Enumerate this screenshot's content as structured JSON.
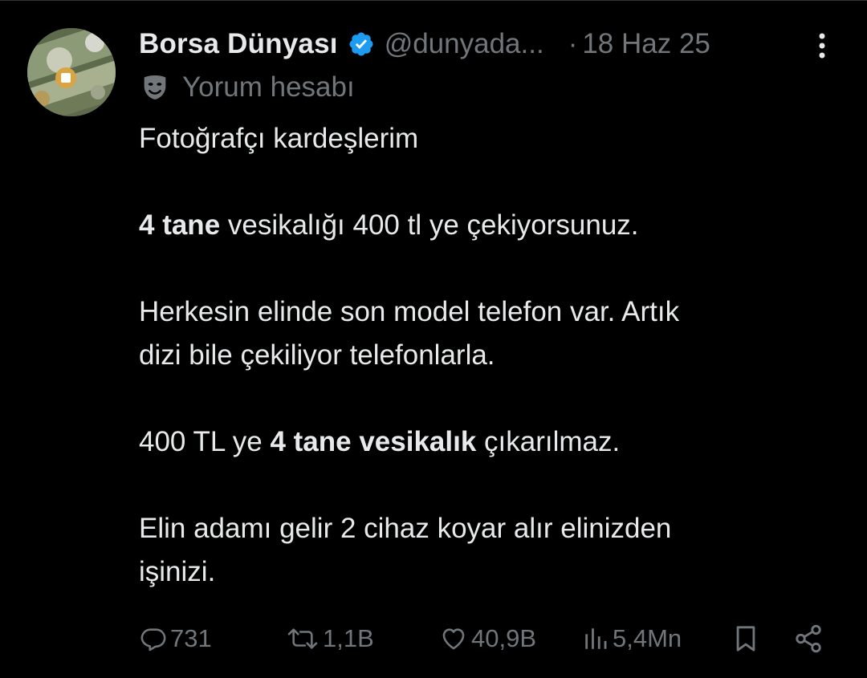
{
  "tweet": {
    "display_name": "Borsa Dünyası",
    "handle": "@dunyada...",
    "separator": "·",
    "timestamp": "18 Haz 25",
    "label": "Yorum hesabı",
    "body": {
      "line1": "Fotoğrafçı kardeşlerim",
      "p2_bold": "4 tane",
      "p2_rest": " vesikalığı 400 tl ye çekiyorsunuz.",
      "p3_line1": "Herkesin elinde son model telefon var. Artık",
      "p3_line2": "dizi bile çekiliyor telefonlarla.",
      "p4_start": "400 TL ye ",
      "p4_bold": "4 tane vesikalık",
      "p4_end": " çıkarılmaz.",
      "p5_line1": "Elin adamı gelir 2 cihaz koyar alır elinizden",
      "p5_line2": "işinizi."
    },
    "actions": {
      "replies": "731",
      "reposts": "1,1B",
      "likes": "40,9B",
      "views": "5,4Mn"
    }
  },
  "icons": {
    "verified": "verified-badge-icon",
    "more": "more-vertical-icon",
    "label": "theater-mask-icon",
    "reply": "reply-bubble-icon",
    "repost": "repost-arrows-icon",
    "like": "heart-icon",
    "views": "bar-chart-icon",
    "bookmark": "bookmark-icon",
    "share": "share-icon"
  },
  "colors": {
    "background": "#000000",
    "text_primary": "#e7e9ea",
    "text_secondary": "#71767b",
    "verified_blue": "#1d9bf0"
  }
}
